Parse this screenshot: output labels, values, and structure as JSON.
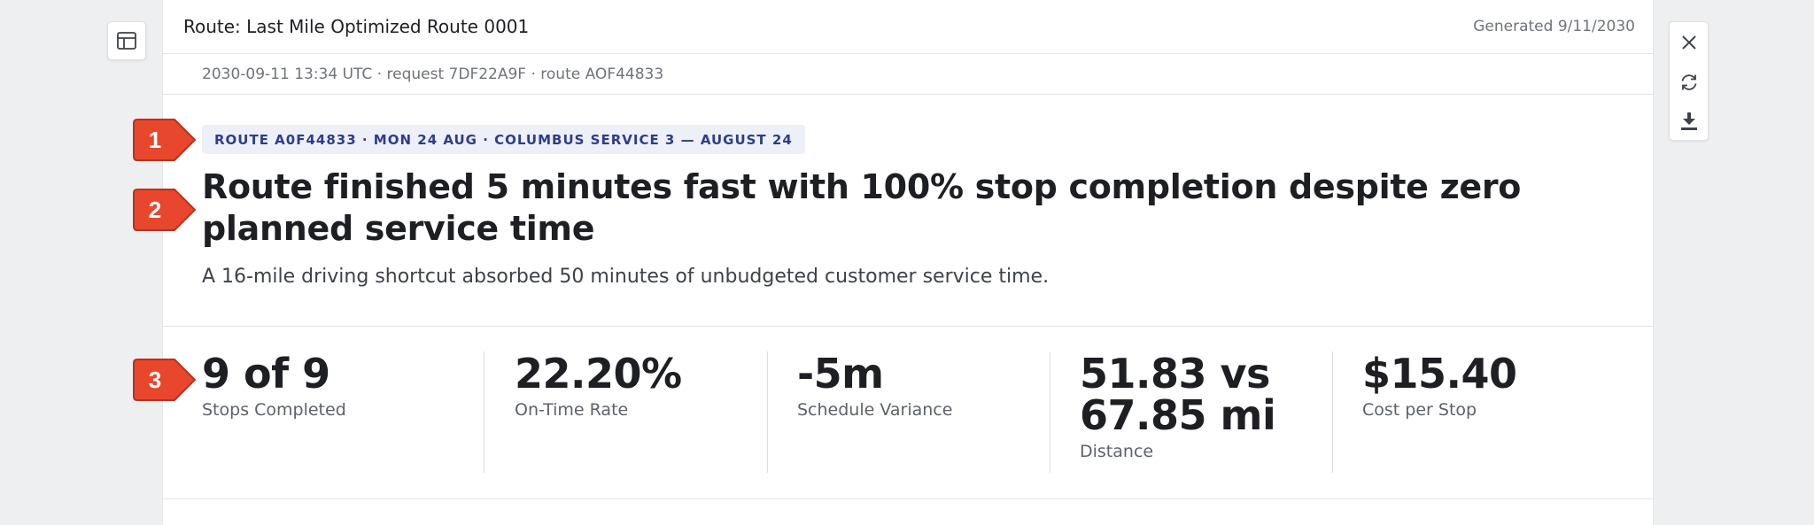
{
  "header": {
    "title": "Route: Last Mile Optimized Route 0001",
    "generated": "Generated 9/11/2030"
  },
  "meta": {
    "line": "2030-09-11 13:34 UTC · request 7DF22A9F · route AOF44833"
  },
  "hero": {
    "badge": "ROUTE A0F44833 · MON 24 AUG · COLUMBUS SERVICE 3 — AUGUST 24",
    "headline": "Route finished 5 minutes fast with 100% stop completion despite zero planned service time",
    "subtitle": "A 16-mile driving shortcut absorbed 50 minutes of unbudgeted customer service time."
  },
  "stats": [
    {
      "value": "9 of 9",
      "label": "Stops Completed"
    },
    {
      "value": "22.20%",
      "label": "On-Time Rate"
    },
    {
      "value": "-5m",
      "label": "Schedule Variance"
    },
    {
      "value": "51.83 vs 67.85 mi",
      "label": "Distance"
    },
    {
      "value": "$15.40",
      "label": "Cost per Stop"
    }
  ],
  "markers": [
    "1",
    "2",
    "3"
  ],
  "icons": {
    "side_toggle": "layout-panel-icon",
    "close": "close-icon",
    "refresh": "refresh-icon",
    "download": "download-icon"
  },
  "colors": {
    "marker": "#e8472d",
    "badge_text": "#2c3d8f",
    "badge_bg": "#eef0f8"
  }
}
